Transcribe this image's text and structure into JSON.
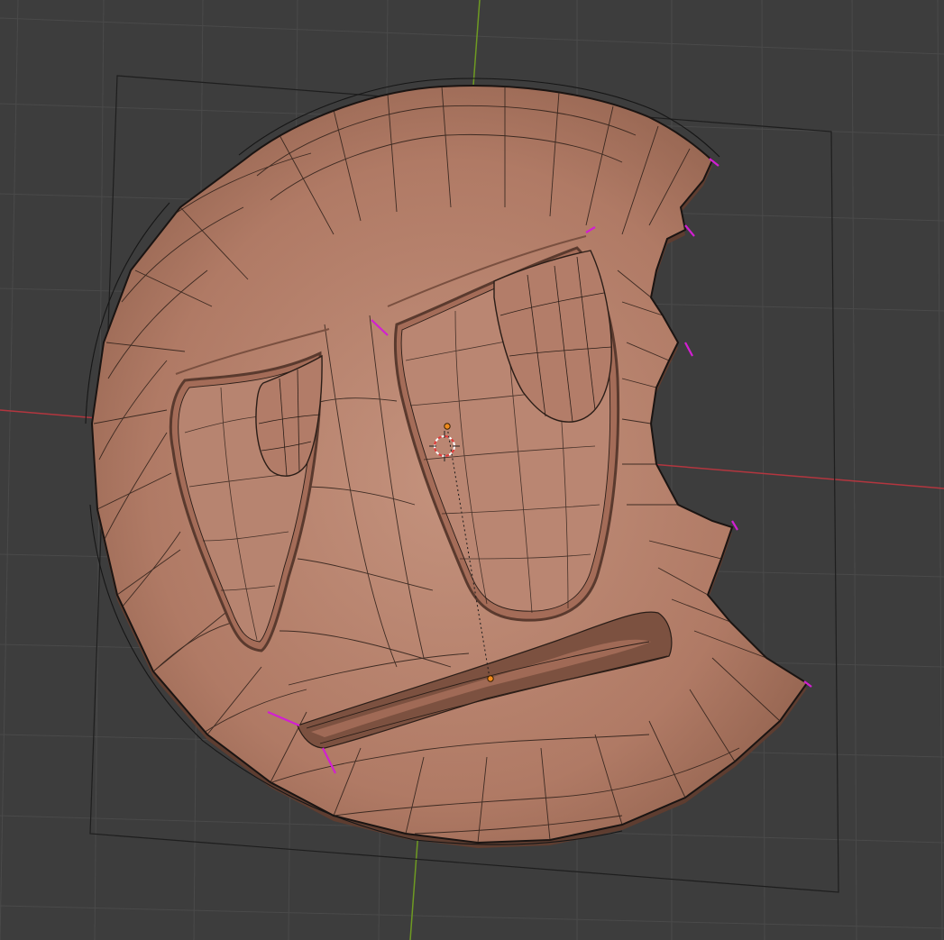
{
  "viewport": {
    "background_color": "#3d3d3d",
    "grid_color": "#474747",
    "x_axis_color": "#c0394a",
    "y_axis_color": "#7aa12a",
    "cage_color": "#1c1c1c"
  },
  "object": {
    "base_color": "#b07a65",
    "light_color": "#c99580",
    "shadow_color": "#7e5444",
    "wire_color": "#2a1d17",
    "seam_color": "#d32fd3",
    "recess_shadow": "#5a3a2e"
  },
  "gizmos": {
    "cursor_icon": "3d-cursor-icon",
    "origin_icon": "object-origin-icon",
    "origin_color": "#f08a1c"
  }
}
